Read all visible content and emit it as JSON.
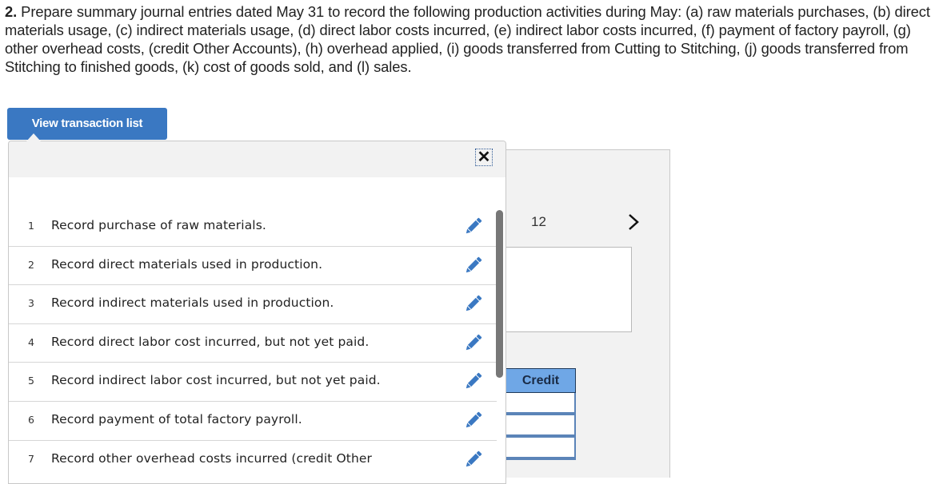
{
  "question": {
    "number": "2.",
    "text": " Prepare summary journal entries dated May 31 to record the following production activities during May: (a) raw materials purchases, (b) direct materials usage, (c) indirect materials usage, (d) direct labor costs incurred, (e) indirect labor costs incurred, (f) payment of factory payroll, (g) other overhead costs, (credit Other Accounts), (h) overhead applied, (i) goods transferred from Cutting to Stitching, (j) goods transferred from Stitching to finished goods, (k) cost of goods sold, and (l) sales."
  },
  "toolbar": {
    "view_transaction_list_label": "View transaction list"
  },
  "popup": {
    "close_icon": "close-icon",
    "items": [
      {
        "num": "1",
        "text": "Record purchase of raw materials.",
        "icon": "pencil-icon"
      },
      {
        "num": "2",
        "text": "Record direct materials used in production.",
        "icon": "pencil-icon"
      },
      {
        "num": "3",
        "text": "Record indirect materials used in production.",
        "icon": "pencil-icon"
      },
      {
        "num": "4",
        "text": "Record direct labor cost incurred, but not yet paid.",
        "icon": "pencil-icon"
      },
      {
        "num": "5",
        "text": "Record indirect labor cost incurred, but not yet paid.",
        "icon": "pencil-icon"
      },
      {
        "num": "6",
        "text": "Record payment of total factory payroll.",
        "icon": "pencil-icon"
      },
      {
        "num": "7",
        "text": "Record other overhead costs incurred (credit Other",
        "icon": "pencil-icon"
      }
    ]
  },
  "journal": {
    "page_indicator": "12",
    "next_icon": "chevron-right-icon",
    "credit_header": "Credit",
    "credit_values": [
      "",
      "",
      ""
    ]
  },
  "colors": {
    "primary_button": "#3a78c2",
    "edit_icon": "#3a78c2",
    "credit_header_bg": "#6fa7e6",
    "panel_bg": "#f2f2f2"
  }
}
